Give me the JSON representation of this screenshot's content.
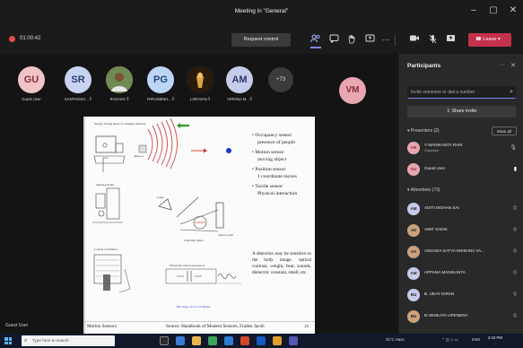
{
  "window": {
    "title": "Meeting in \"General\"",
    "minimize": "–",
    "maximize": "▢",
    "close": "✕"
  },
  "toolbar": {
    "timer": "01:00:42",
    "request_control": "Request control",
    "leave": "Leave",
    "more": "···"
  },
  "strip": {
    "participants": [
      {
        "initials": "GU",
        "name": "Guest User",
        "color": "#efc3c7"
      },
      {
        "initials": "SR",
        "name": "SANTHOSH... ⁑",
        "color": "#c7d3ef"
      },
      {
        "initials": "",
        "name": "RAGHAV ⁑",
        "color": "#8a6a4a"
      },
      {
        "initials": "PG",
        "name": "PARAMESH... ⁑",
        "color": "#bcd4f5"
      },
      {
        "initials": "",
        "name": "LSRAVAN ⁑",
        "color": "#5a3a1a"
      },
      {
        "initials": "AM",
        "name": "ARPANA M... ⁑",
        "color": "#c5cbe8"
      }
    ],
    "more_count": "+73",
    "big_avatar": "VM"
  },
  "slide": {
    "bullets": [
      {
        "head": "Occupancy sensor",
        "sub": "presence of people"
      },
      {
        "head": "Motion sensor",
        "sub": "moving object"
      },
      {
        "head": "Position sensor",
        "sub": "1 coordinate moves"
      },
      {
        "head": "Tactile sensor",
        "sub": "Physical interaction"
      }
    ],
    "paragraph": "A detection may be sensitive to the body image, optical contrast, weight, heat, sounds, dielectric constant, smell, etc.",
    "footer_left": "Motion Sensors",
    "footer_source": "Source: Handbook of Modern Sensors, Fraden Jacob",
    "footer_page": "15",
    "labels": {
      "top_left": "Energy Saving mode of computer Monitor",
      "detector": "detector",
      "top_arrow": "",
      "mid_left": "Sanitary/Toilet",
      "bottom_left": "Control of Window",
      "optical_path": "Optical path",
      "reflecting_object": "reflecting object",
      "laser": "Laser",
      "mid_bottom": "Ultrasonic sensor (presence)",
      "bottom_caption": "Bar range of 2 to 12 Meters"
    }
  },
  "host_label": "Guest User",
  "panel": {
    "title": "Participants",
    "search_placeholder": "Invite someone or dial a number",
    "share_invite": "Share invite",
    "presenters_header": "Presenters (2)",
    "mute_all": "Mute all",
    "presenters": [
      {
        "initials": "VM",
        "name": "V MANIKANTA RAM",
        "sub": "Organizer",
        "color": "#e8a7b0"
      },
      {
        "initials": "GU",
        "name": "Guest User",
        "sub": "",
        "color": "#e8a7b0"
      }
    ],
    "attendees_header": "Attendees (73)",
    "attendees": [
      {
        "initials": "AM",
        "name": "ADITI MOHAN SAI",
        "color": "#c5cbe8"
      },
      {
        "initials": "AD",
        "name": "AMIT SADIK",
        "color": "#c9a27b"
      },
      {
        "initials": "AS",
        "name": "ANGADA SATYA KRISHNA VA...",
        "color": "#c9a27b"
      },
      {
        "initials": "AM",
        "name": "APPANA MANIKANTA",
        "color": "#c5cbe8"
      },
      {
        "initials": "BU",
        "name": "B. UDAY KIRAN",
        "color": "#c5cbe8"
      },
      {
        "initials": "BU",
        "name": "B.VENKATA UPENDRA",
        "color": "#c9a27b"
      }
    ]
  },
  "taskbar": {
    "search_placeholder": "Type here to search",
    "weather": "31°C Haze",
    "lang": "ENG",
    "time": "2:42 PM",
    "date": "..."
  }
}
